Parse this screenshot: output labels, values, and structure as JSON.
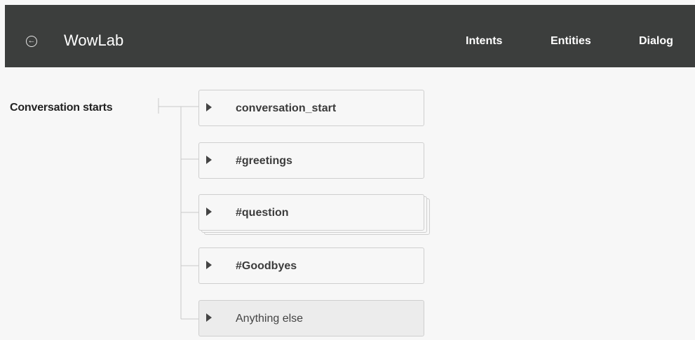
{
  "header": {
    "back_glyph": "←",
    "title": "WowLab",
    "nav": [
      "Intents",
      "Entities",
      "Dialog"
    ]
  },
  "dialog": {
    "start_label": "Conversation starts",
    "nodes": [
      {
        "label": "conversation_start"
      },
      {
        "label": "#greetings"
      },
      {
        "label": "#question"
      },
      {
        "label": "#Goodbyes"
      },
      {
        "label": "Anything else"
      }
    ]
  }
}
